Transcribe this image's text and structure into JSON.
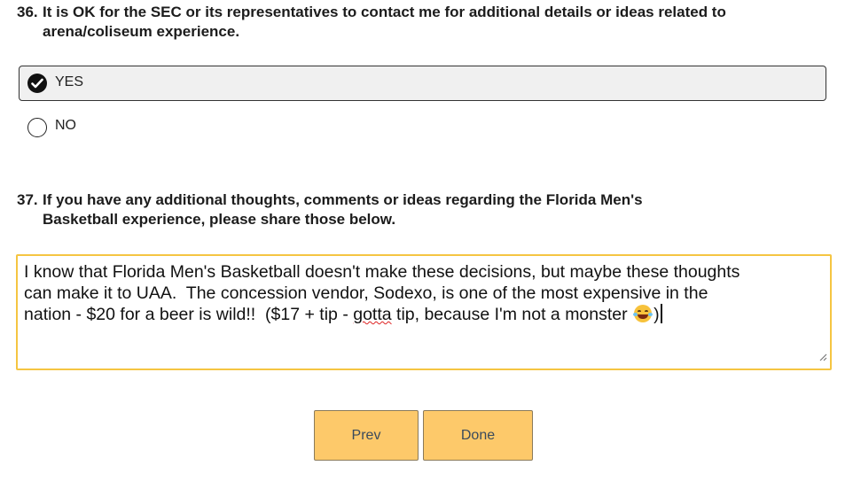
{
  "q36": {
    "number": "36.",
    "line1": "It is OK for the SEC or its representatives to contact me for additional details or ideas related to",
    "line2": "arena/coliseum experience.",
    "options": [
      {
        "label": "YES",
        "selected": true
      },
      {
        "label": "NO",
        "selected": false
      }
    ]
  },
  "q37": {
    "number": "37.",
    "line1": "If you have any additional thoughts, comments or ideas regarding the Florida Men's",
    "line2": "Basketball experience, please share those below.",
    "answer": {
      "line1": "I know that Florida Men's Basketball doesn't make these decisions, but maybe these thoughts",
      "line2": "can make it to UAA.  The concession vendor, Sodexo, is one of the most expensive in the",
      "line3_part1": "nation - $20 for a beer is wild!!  ($17 + tip - ",
      "line3_misspelled": "gotta",
      "line3_part2": " tip, because I'm not a monster ",
      "line3_end": ")",
      "emoji": "face-with-tears-of-joy"
    }
  },
  "buttons": {
    "prev": "Prev",
    "done": "Done"
  },
  "colors": {
    "button_bg": "#fdc96a",
    "textarea_border": "#f5c542",
    "selected_bg": "#f0f0f0"
  }
}
